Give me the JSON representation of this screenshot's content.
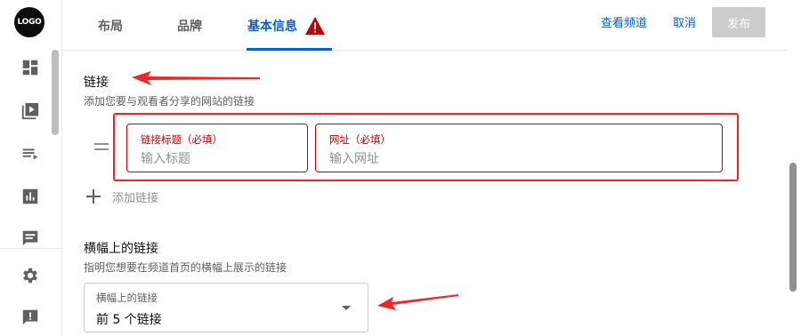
{
  "rail": {
    "logo_text": "LOGO",
    "icons": [
      "dashboard-icon",
      "content-icon",
      "playlists-icon",
      "analytics-icon",
      "comments-icon",
      "settings-icon",
      "feedback-icon"
    ]
  },
  "header": {
    "tabs": [
      {
        "label": "布局"
      },
      {
        "label": "品牌"
      },
      {
        "label": "基本信息",
        "active": true,
        "warning": true
      }
    ],
    "view_channel": "查看频道",
    "cancel": "取消",
    "publish": "发布"
  },
  "links_section": {
    "title": "链接",
    "subtitle": "添加您要与观看者分享的网站的链接",
    "title_field": {
      "label": "链接标题（必填）",
      "placeholder": "输入标题",
      "value": ""
    },
    "url_field": {
      "label": "网址（必填）",
      "placeholder": "输入网址",
      "value": ""
    },
    "add_link": "添加链接"
  },
  "banner_section": {
    "title": "横幅上的链接",
    "subtitle": "指明您想要在频道首页的横幅上展示的链接",
    "select_label": "横幅上的链接",
    "select_value": "前 5 个链接"
  },
  "colors": {
    "accent": "#065fd4",
    "error": "#cc0000",
    "annotation": "#f42424",
    "warning": "#c00000"
  }
}
